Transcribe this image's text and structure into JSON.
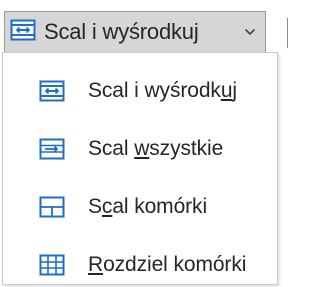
{
  "split_button": {
    "label": "Scal i wyśrodkuj",
    "icon": "merge-center-icon",
    "arrow_icon": "chevron-down-icon"
  },
  "colors": {
    "icon_blue": "#1f6fc5",
    "text": "#262626",
    "button_bg": "#d6d6d6"
  },
  "menu": {
    "items": [
      {
        "label": "Scal i wyśrodkuj",
        "before": "Scal i wyśrodk",
        "accel": "u",
        "after": "j",
        "icon": "merge-center-icon"
      },
      {
        "label": "Scal wszystkie",
        "before": "Scal ",
        "accel": "w",
        "after": "szystkie",
        "icon": "merge-across-icon"
      },
      {
        "label": "Scal komórki",
        "before": "S",
        "accel": "c",
        "after": "al komórki",
        "icon": "merge-cells-icon"
      },
      {
        "label": "Rozdziel komórki",
        "before": "",
        "accel": "R",
        "after": "ozdziel komórki",
        "icon": "unmerge-cells-icon"
      }
    ]
  }
}
